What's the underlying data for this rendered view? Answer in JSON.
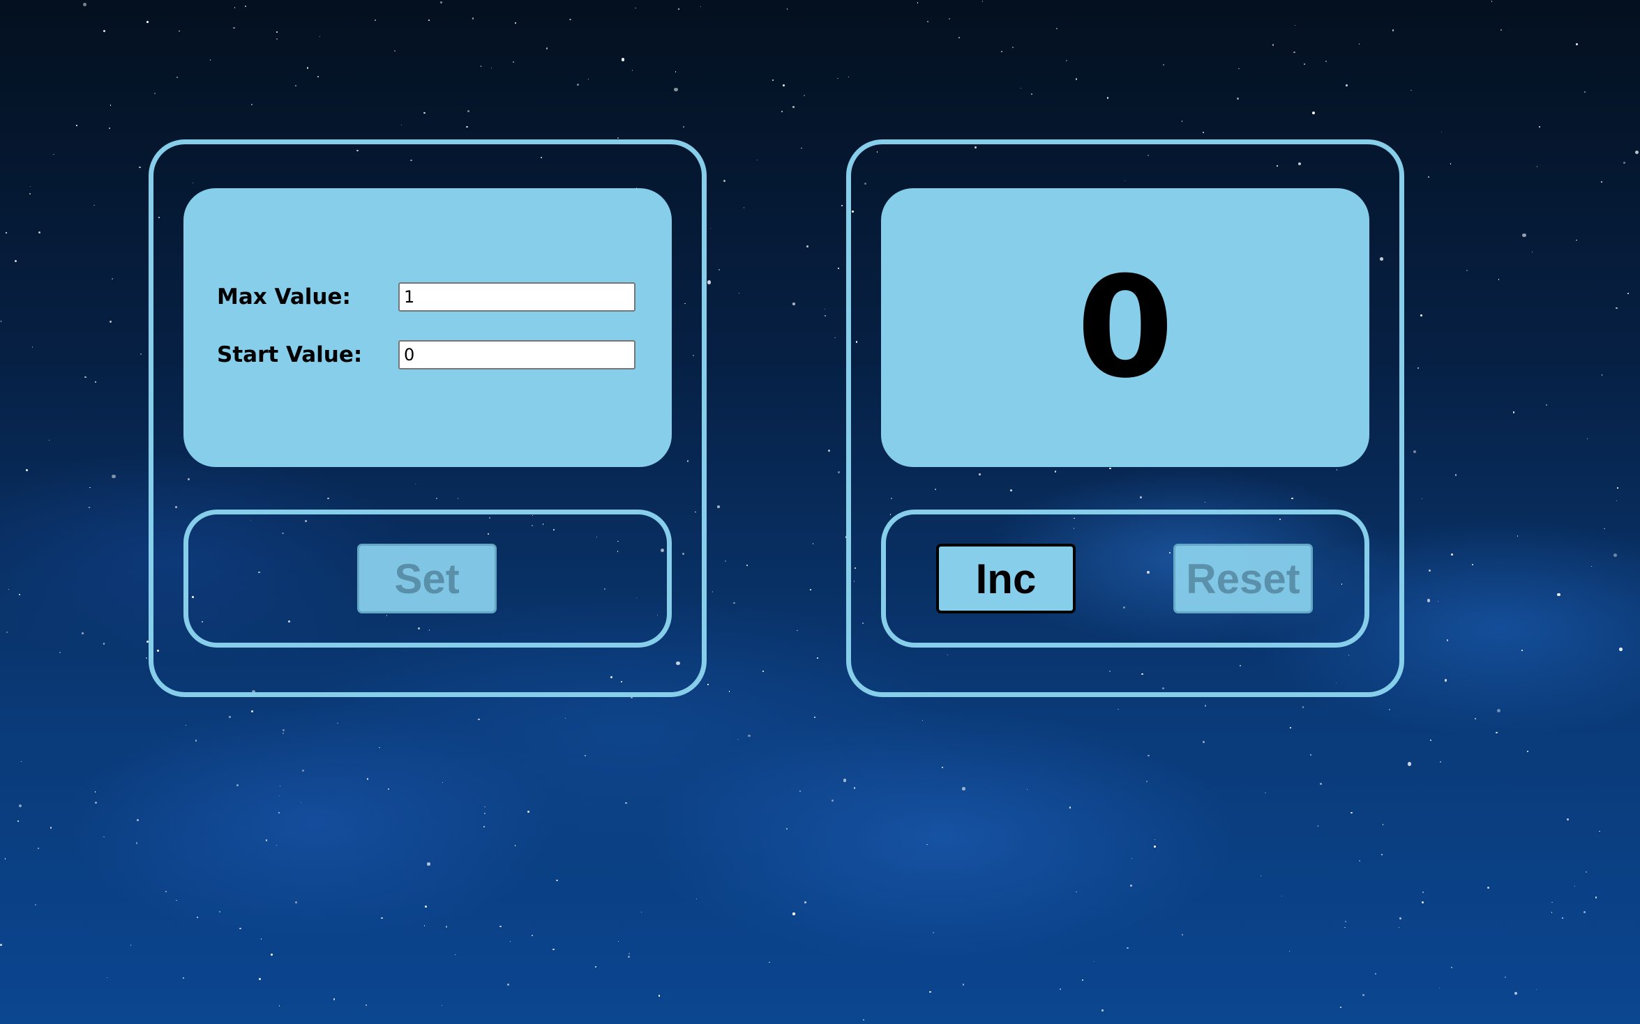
{
  "settings_panel": {
    "max_label": "Max Value:",
    "max_value": "1",
    "start_label": "Start Value:",
    "start_value": "0",
    "set_button": "Set",
    "set_disabled": true
  },
  "counter_panel": {
    "value": "0",
    "inc_button": "Inc",
    "inc_disabled": false,
    "reset_button": "Reset",
    "reset_disabled": true
  },
  "colors": {
    "accent": "#87ceeb",
    "background": "#0a3a78"
  }
}
